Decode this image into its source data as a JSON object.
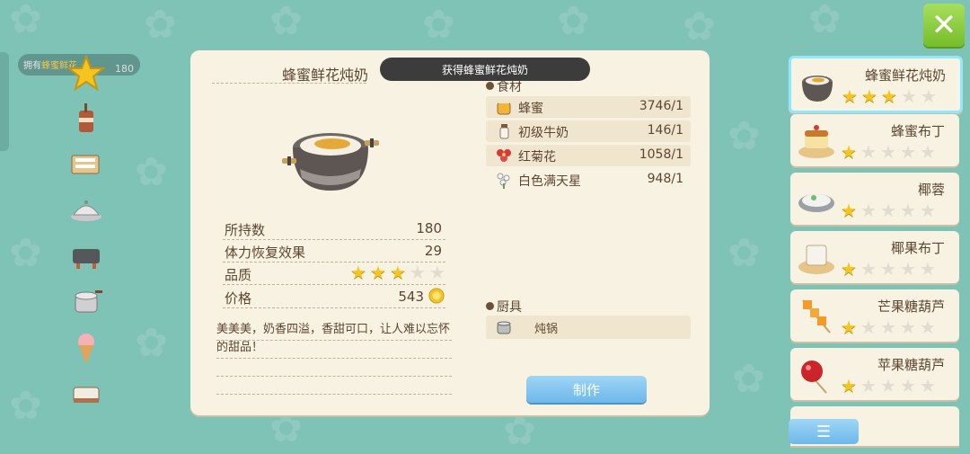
{
  "counter": {
    "label_a": "拥有",
    "label_b": "蜂蜜鲜花",
    "value": "180"
  },
  "toast": "获得蜂蜜鲜花炖奶",
  "item": {
    "title": "蜂蜜鲜花炖奶",
    "stats": [
      {
        "label": "所持数",
        "value": "180"
      },
      {
        "label": "体力恢复效果",
        "value": "29"
      },
      {
        "label": "品质",
        "stars": 3,
        "max": 5
      },
      {
        "label": "价格",
        "value": "543"
      }
    ],
    "description": "美美美，奶香四溢，香甜可口，让人难以忘怀的甜品！"
  },
  "ingredients": {
    "title": "食材",
    "items": [
      {
        "icon": "honey-jar-icon",
        "name": "蜂蜜",
        "amount": "3746/1"
      },
      {
        "icon": "milk-bottle-icon",
        "name": "初级牛奶",
        "amount": "146/1"
      },
      {
        "icon": "red-chrysanthemum-icon",
        "name": "红菊花",
        "amount": "1058/1"
      },
      {
        "icon": "babys-breath-icon",
        "name": "白色满天星",
        "amount": "948/1"
      }
    ]
  },
  "cookware": {
    "title": "厨具",
    "item": "炖锅",
    "icon": "stew-pot-icon"
  },
  "make_label": "制作",
  "recipes": [
    {
      "name": "蜂蜜鲜花炖奶",
      "stars": 3,
      "selected": true
    },
    {
      "name": "蜂蜜布丁",
      "stars": 1
    },
    {
      "name": "椰蓉",
      "stars": 1
    },
    {
      "name": "椰果布丁",
      "stars": 1
    },
    {
      "name": "芒果糖葫芦",
      "stars": 1
    },
    {
      "name": "苹果糖葫芦",
      "stars": 1
    }
  ],
  "colors": {
    "accent_blue": "#6db8ea",
    "close_green": "#75bd2b",
    "star_gold": "#f4c521",
    "panel": "#f8f2e2"
  }
}
